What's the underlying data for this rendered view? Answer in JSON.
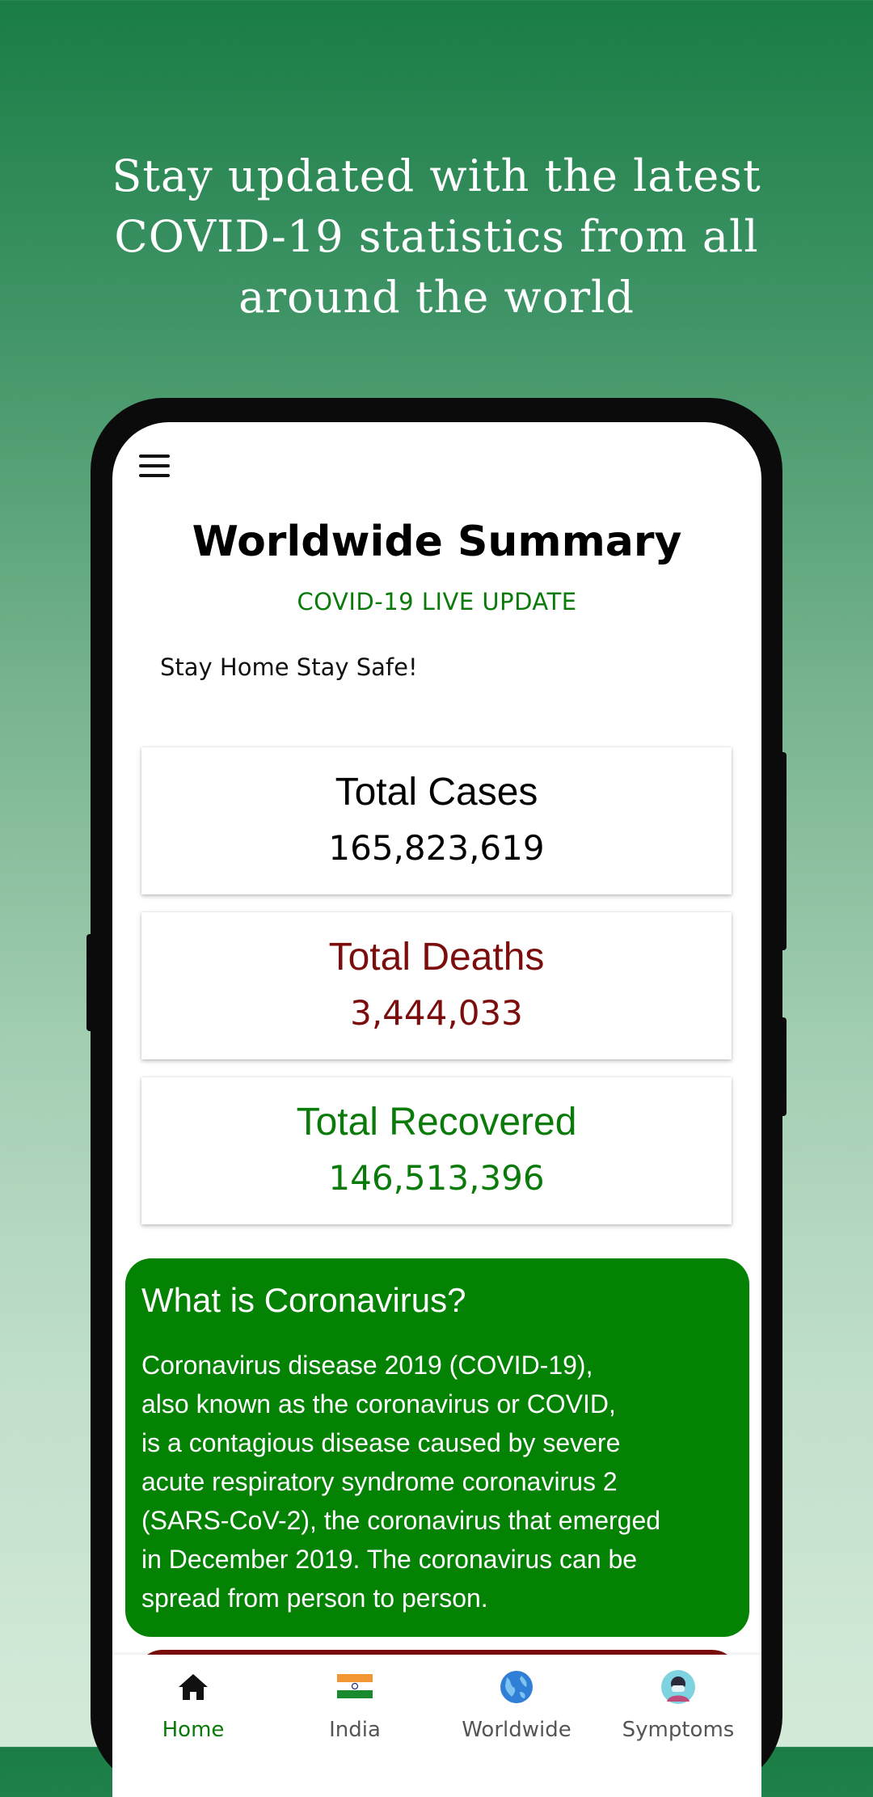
{
  "promo": {
    "headline_line1": "Stay updated with the latest",
    "headline_line2": "COVID-19 statistics from all",
    "headline_line3": "around the world"
  },
  "app": {
    "title": "Worldwide Summary",
    "subtitle": "COVID-19 LIVE UPDATE",
    "tagline": "Stay Home Stay Safe!",
    "menu_icon": "hamburger-menu-icon"
  },
  "stats": {
    "total_cases": {
      "label": "Total Cases",
      "value": "165,823,619",
      "color": "#000000"
    },
    "total_deaths": {
      "label": "Total Deaths",
      "value": "3,444,033",
      "color": "#7c0d0d"
    },
    "total_recovered": {
      "label": "Total Recovered",
      "value": "146,513,396",
      "color": "#0a7a0a"
    }
  },
  "info": {
    "title": "What is Coronavirus?",
    "body_lines": [
      "Coronavirus disease 2019 (COVID-19),",
      "also known as the coronavirus or COVID,",
      "is a contagious disease caused by severe",
      "acute respiratory syndrome coronavirus 2",
      "(SARS-CoV-2), the coronavirus that emerged",
      "in December 2019. The coronavirus can be",
      "spread from person to person."
    ],
    "background": "#048204"
  },
  "nav": {
    "items": [
      {
        "label": "Home",
        "icon": "home-icon",
        "active": true
      },
      {
        "label": "India",
        "icon": "india-flag-icon",
        "active": false
      },
      {
        "label": "Worldwide",
        "icon": "globe-icon",
        "active": false
      },
      {
        "label": "Symptoms",
        "icon": "masked-person-icon",
        "active": false
      }
    ]
  },
  "colors": {
    "accent_green": "#0a7a0a",
    "deaths_red": "#7c0d0d"
  }
}
